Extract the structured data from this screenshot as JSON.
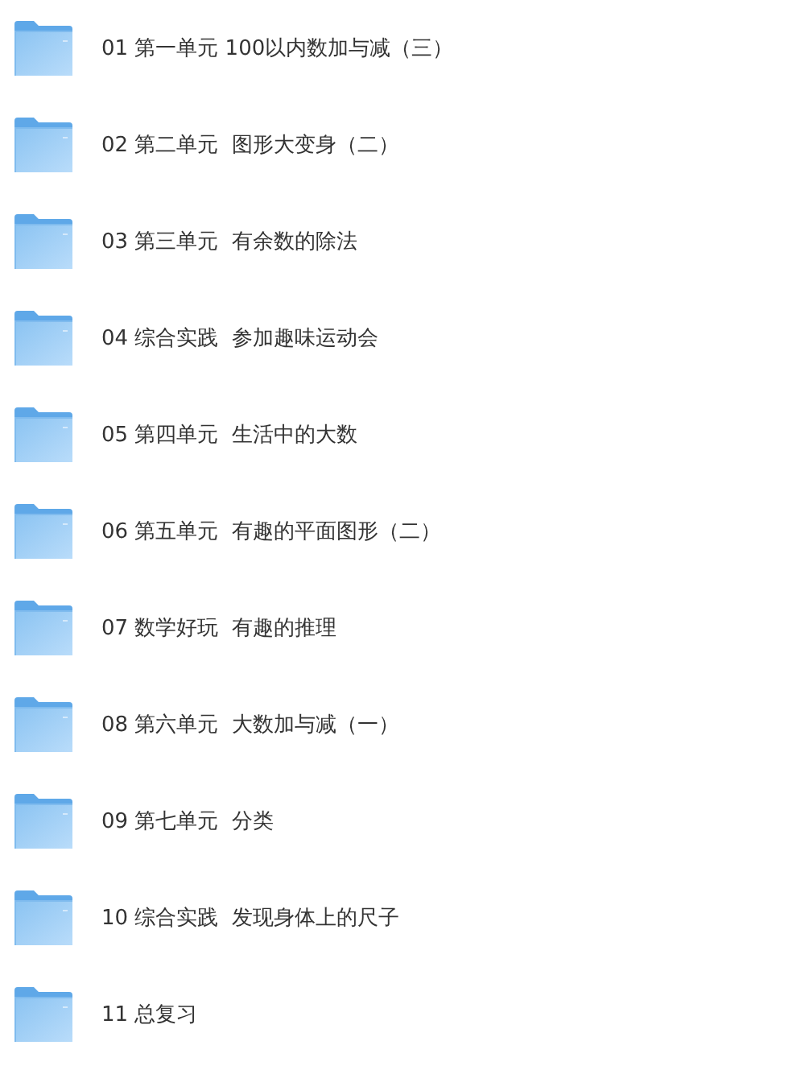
{
  "folders": [
    {
      "name": "01 第一单元 100以内数加与减（三）"
    },
    {
      "name": "02 第二单元  图形大变身（二）"
    },
    {
      "name": "03 第三单元  有余数的除法"
    },
    {
      "name": "04 综合实践  参加趣味运动会"
    },
    {
      "name": "05 第四单元  生活中的大数"
    },
    {
      "name": "06 第五单元  有趣的平面图形（二）"
    },
    {
      "name": "07 数学好玩  有趣的推理"
    },
    {
      "name": "08 第六单元  大数加与减（一）"
    },
    {
      "name": "09 第七单元  分类"
    },
    {
      "name": "10 综合实践  发现身体上的尺子"
    },
    {
      "name": "11 总复习"
    }
  ]
}
